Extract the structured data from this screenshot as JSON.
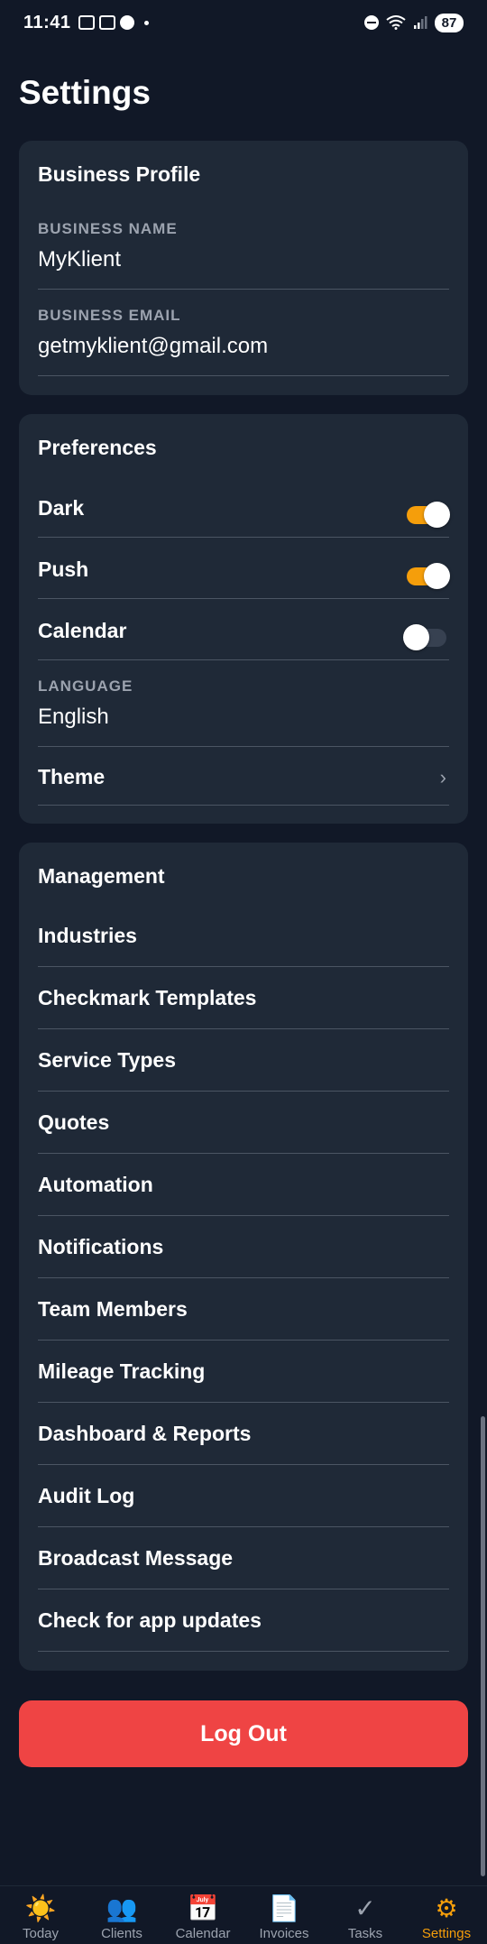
{
  "status_bar": {
    "time": "11:41",
    "battery": "87"
  },
  "page_title": "Settings",
  "business_profile": {
    "heading": "Business Profile",
    "name_label": "BUSINESS NAME",
    "name_value": "MyKlient",
    "email_label": "BUSINESS EMAIL",
    "email_value": "getmyklient@gmail.com"
  },
  "preferences": {
    "heading": "Preferences",
    "toggles": [
      {
        "label": "Dark",
        "state": "on"
      },
      {
        "label": "Push",
        "state": "on"
      },
      {
        "label": "Calendar",
        "state": "off"
      }
    ],
    "language_label": "LANGUAGE",
    "language_value": "English",
    "theme_label": "Theme",
    "chevron": "›"
  },
  "management": {
    "heading": "Management",
    "items": [
      "Industries",
      "Checkmark Templates",
      "Service Types",
      "Quotes",
      "Automation",
      "Notifications",
      "Team Members",
      "Mileage Tracking",
      "Dashboard & Reports",
      "Audit Log",
      "Broadcast Message",
      "Check for app updates"
    ]
  },
  "logout_label": "Log Out",
  "tabs": [
    {
      "label": "Today",
      "icon": "sun-icon",
      "glyph": "☀️",
      "active": false
    },
    {
      "label": "Clients",
      "icon": "people-icon",
      "glyph": "👥",
      "active": false
    },
    {
      "label": "Calendar",
      "icon": "calendar-icon",
      "glyph": "📅",
      "active": false
    },
    {
      "label": "Invoices",
      "icon": "invoice-icon",
      "glyph": "📄",
      "active": false
    },
    {
      "label": "Tasks",
      "icon": "checkmark-icon",
      "glyph": "✓",
      "active": false
    },
    {
      "label": "Settings",
      "icon": "gear-icon",
      "glyph": "⚙",
      "active": true
    }
  ],
  "colors": {
    "background": "#111827",
    "card": "#1f2937",
    "accent": "#f59e0b",
    "danger": "#ef4444",
    "muted": "#9ca3af"
  }
}
